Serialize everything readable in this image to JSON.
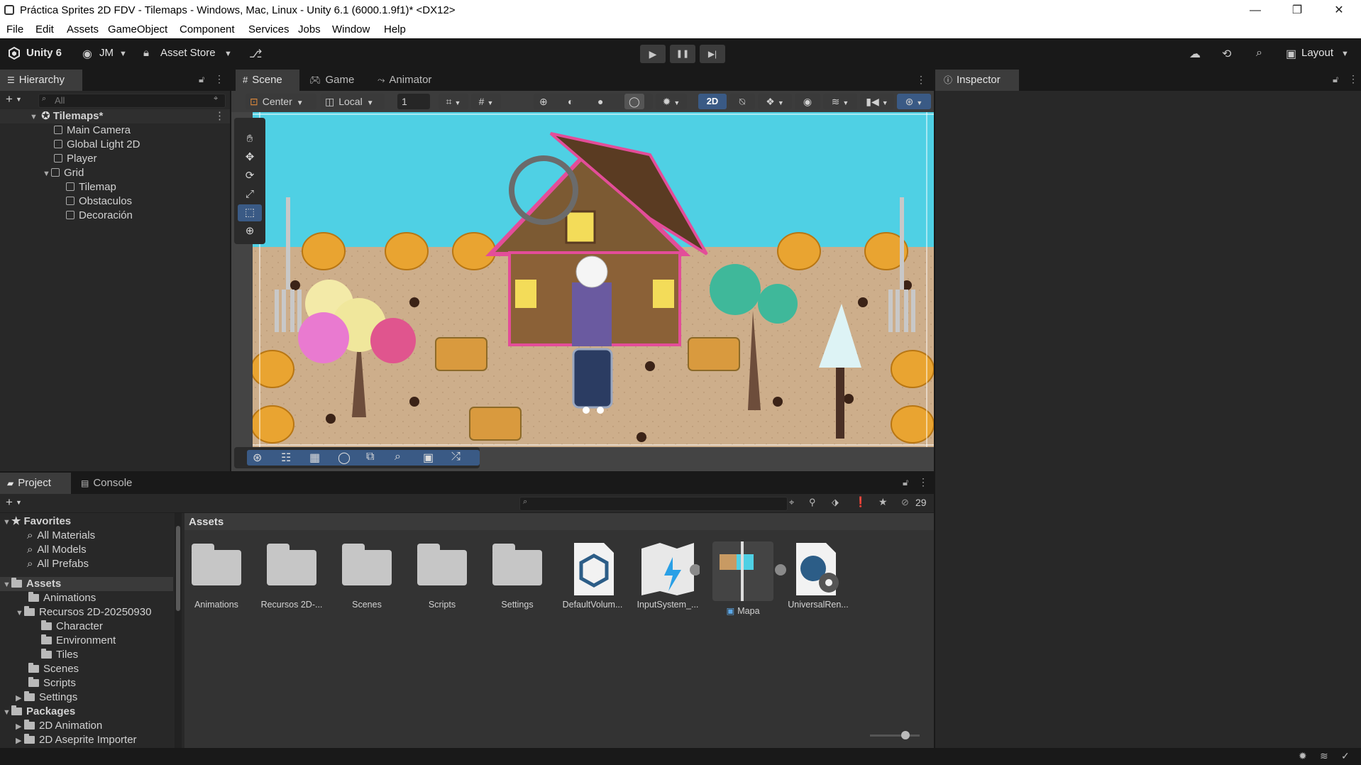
{
  "window": {
    "title": "Práctica Sprites 2D FDV - Tilemaps - Windows, Mac, Linux - Unity 6.1 (6000.1.9f1)* <DX12>",
    "minimize": "—",
    "maximize": "❐",
    "close": "✕"
  },
  "menu": [
    "File",
    "Edit",
    "Assets",
    "GameObject",
    "Component",
    "Services",
    "Jobs",
    "Window",
    "Help"
  ],
  "toolbar": {
    "unity_label": "Unity 6",
    "account": "JM",
    "asset_store": "Asset Store",
    "layout": "Layout",
    "play": "▶",
    "pause": "❚❚",
    "step": "▶|"
  },
  "hierarchy": {
    "tab": "Hierarchy",
    "search_placeholder": "All",
    "scene_name": "Tilemaps*",
    "items": [
      {
        "label": "Main Camera"
      },
      {
        "label": "Global Light 2D"
      },
      {
        "label": "Player"
      },
      {
        "label": "Grid"
      },
      {
        "label": "Tilemap"
      },
      {
        "label": "Obstaculos"
      },
      {
        "label": "Decoración"
      }
    ]
  },
  "scene_tabs": [
    "Scene",
    "Game",
    "Animator"
  ],
  "scene_toolbar": {
    "pivot": "Center",
    "space": "Local",
    "grid_value": "1",
    "mode_2d": "2D"
  },
  "inspector": {
    "tab": "Inspector"
  },
  "bottom_tabs": [
    "Project",
    "Console"
  ],
  "project": {
    "favorites_label": "Favorites",
    "favorites": [
      "All Materials",
      "All Models",
      "All Prefabs"
    ],
    "assets_label": "Assets",
    "tree": [
      {
        "label": "Animations"
      },
      {
        "label": "Recursos 2D-20250930"
      },
      {
        "label": "Character"
      },
      {
        "label": "Environment"
      },
      {
        "label": "Tiles"
      },
      {
        "label": "Scenes"
      },
      {
        "label": "Scripts"
      },
      {
        "label": "Settings"
      }
    ],
    "packages_label": "Packages",
    "packages": [
      "2D Animation",
      "2D Aseprite Importer"
    ],
    "breadcrumb": "Assets",
    "hidden_count": "29",
    "grid_items": [
      {
        "label": "Animations",
        "kind": "folder"
      },
      {
        "label": "Recursos 2D-...",
        "kind": "folder"
      },
      {
        "label": "Scenes",
        "kind": "folder"
      },
      {
        "label": "Scripts",
        "kind": "folder"
      },
      {
        "label": "Settings",
        "kind": "folder"
      },
      {
        "label": "DefaultVolum...",
        "kind": "volume"
      },
      {
        "label": "InputSystem_...",
        "kind": "input"
      },
      {
        "label": "Mapa",
        "kind": "prefab"
      },
      {
        "label": "UniversalRen...",
        "kind": "settings"
      }
    ]
  },
  "colors": {
    "sky": "#4fd0e4",
    "ground": "#cdae8b",
    "accent_blue": "#2c5d87"
  }
}
